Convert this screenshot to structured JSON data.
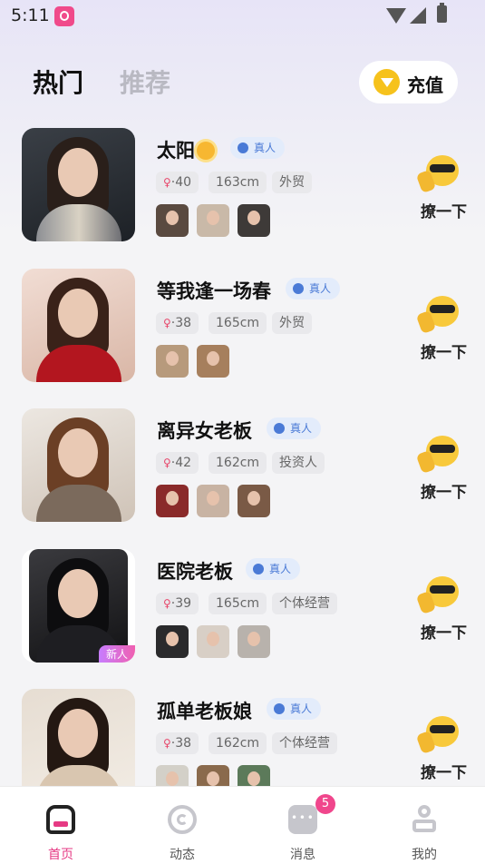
{
  "status_bar": {
    "time": "5:11"
  },
  "header": {
    "tabs": [
      "热门",
      "推荐"
    ],
    "active_tab": "热门",
    "recharge_label": "充值"
  },
  "profiles": [
    {
      "name": "太阳",
      "has_sun_emoji": true,
      "verified_label": "真人",
      "age": "·40",
      "height": "163cm",
      "job": "外贸",
      "photo_count": 3,
      "is_new": false,
      "action_label": "撩一下"
    },
    {
      "name": "等我逢一场春",
      "verified_label": "真人",
      "age": "·38",
      "height": "165cm",
      "job": "外贸",
      "photo_count": 2,
      "is_new": false,
      "action_label": "撩一下"
    },
    {
      "name": "离异女老板",
      "verified_label": "真人",
      "age": "·42",
      "height": "162cm",
      "job": "投资人",
      "photo_count": 3,
      "is_new": false,
      "action_label": "撩一下"
    },
    {
      "name": "医院老板",
      "verified_label": "真人",
      "age": "·39",
      "height": "165cm",
      "job": "个体经营",
      "photo_count": 3,
      "is_new": true,
      "new_label": "新人",
      "action_label": "撩一下"
    },
    {
      "name": "孤单老板娘",
      "verified_label": "真人",
      "age": "·38",
      "height": "162cm",
      "job": "个体经营",
      "photo_count": 3,
      "is_new": false,
      "action_label": "撩一下"
    }
  ],
  "bottom_nav": {
    "items": [
      {
        "label": "首页",
        "icon": "home-icon",
        "active": true
      },
      {
        "label": "动态",
        "icon": "moments-icon",
        "active": false
      },
      {
        "label": "消息",
        "icon": "message-icon",
        "active": false,
        "badge": "5"
      },
      {
        "label": "我的",
        "icon": "profile-icon",
        "active": false
      }
    ]
  },
  "colors": {
    "accent": "#e63a84",
    "verified": "#4a7ad6",
    "coin": "#f6c21c"
  }
}
